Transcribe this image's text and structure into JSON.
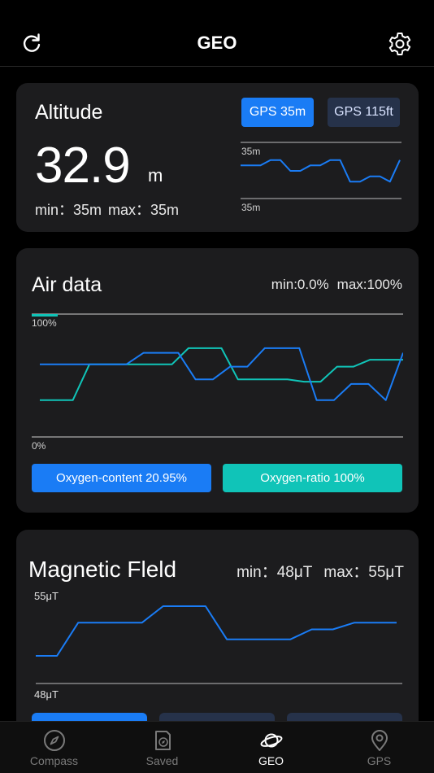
{
  "header": {
    "title": "GEO",
    "refresh_icon": "refresh-icon",
    "settings_icon": "gear-icon"
  },
  "altitude": {
    "title": "Altitude",
    "value": "32.9",
    "unit": "m",
    "min_text": "min：35m",
    "max_text": "max：35m",
    "gps_m_label": "GPS 35m",
    "gps_ft_label": "GPS 115ft",
    "chart_top_label": "35m",
    "chart_bottom_label": "35m",
    "color": "#1a7cf5"
  },
  "air": {
    "title": "Air data",
    "min_text": "min:0.0%",
    "max_text": "max:100%",
    "top_label": "100%",
    "bottom_label": "0%",
    "oxygen_content_label": "Oxygen-content  20.95%",
    "oxygen_ratio_label": "Oxygen-ratio  100%",
    "colors": {
      "content": "#1a7cf5",
      "ratio": "#10c4b8"
    }
  },
  "magnetic": {
    "title": "Magnetic Fleld",
    "min_text": "min：48μT",
    "max_text": "max：55μT",
    "top_label": "55μT",
    "bottom_label": "48μT"
  },
  "tabbar": {
    "items": [
      {
        "label": "Compass",
        "icon": "compass-icon",
        "active": false
      },
      {
        "label": "Saved",
        "icon": "saved-icon",
        "active": false
      },
      {
        "label": "GEO",
        "icon": "planet-icon",
        "active": true
      },
      {
        "label": "GPS",
        "icon": "location-pin-icon",
        "active": false
      }
    ]
  },
  "chart_data": [
    {
      "type": "line",
      "title": "Altitude",
      "ylim_labels": [
        "35m",
        "35m"
      ],
      "series": [
        {
          "values": [
            4,
            4,
            4,
            5,
            5,
            3,
            3,
            4,
            4,
            5,
            5,
            1,
            1,
            2,
            2,
            1,
            5
          ]
        }
      ]
    },
    {
      "type": "line",
      "title": "Air data",
      "ylim": [
        0,
        100
      ],
      "series": [
        {
          "values": [
            60,
            60,
            60,
            60,
            60,
            60,
            70,
            70,
            70,
            47,
            47,
            58,
            58,
            74,
            74,
            74,
            29,
            29,
            43,
            43,
            29,
            70
          ]
        },
        {
          "values": [
            29,
            29,
            29,
            60,
            60,
            60,
            60,
            60,
            60,
            74,
            74,
            74,
            47,
            47,
            47,
            47,
            45,
            45,
            58,
            58,
            64,
            64,
            64
          ]
        }
      ]
    },
    {
      "type": "line",
      "title": "Magnetic Fleld",
      "ylim_labels": [
        "48μT",
        "55μT"
      ],
      "series": [
        {
          "values": [
            1,
            1,
            3,
            3,
            3,
            3,
            4,
            4,
            4,
            2,
            2,
            2,
            2,
            2.6,
            2.6,
            3,
            3,
            3
          ]
        }
      ]
    }
  ]
}
